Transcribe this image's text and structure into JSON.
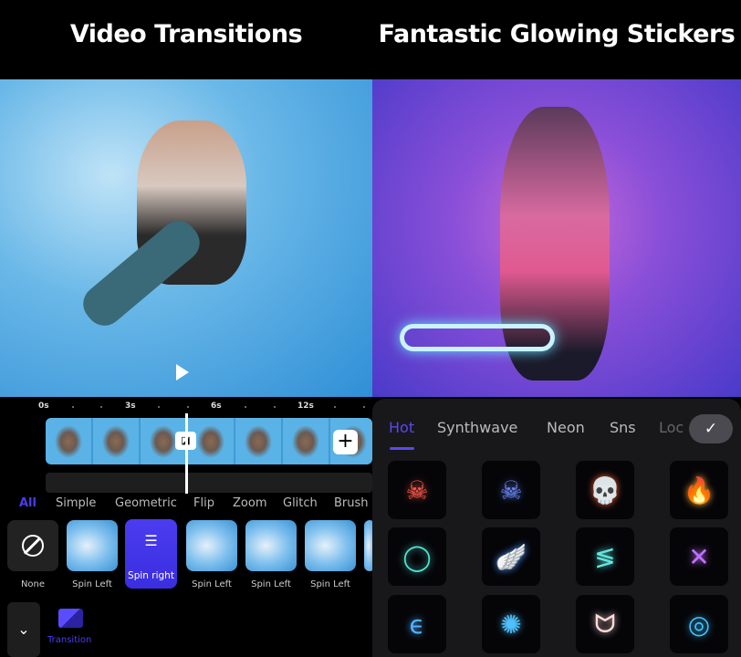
{
  "headlines": {
    "left": "Video Transitions",
    "right": "Fantastic Glowing Stickers"
  },
  "editor": {
    "timeline_ticks": [
      "0s",
      "3s",
      "6s",
      "12s"
    ],
    "transition_tabs": [
      "All",
      "Simple",
      "Geometric",
      "Flip",
      "Zoom",
      "Glitch",
      "Brush"
    ],
    "active_tab": "All",
    "transitions": [
      {
        "label": "None",
        "icon": "none-icon"
      },
      {
        "label": "Spin Left"
      },
      {
        "label": "Spin right",
        "selected": true,
        "icon": "sliders-icon"
      },
      {
        "label": "Spin Left"
      },
      {
        "label": "Spin Left"
      },
      {
        "label": "Spin Left"
      }
    ],
    "bottom_tool": "Transition",
    "accent": "#4a3cf0"
  },
  "stickers": {
    "tabs": [
      "Hot",
      "Synthwave",
      "Neon",
      "Sns",
      "Loc"
    ],
    "active_tab": "Hot",
    "items": [
      {
        "name": "neon-skull-red-icon",
        "glyph": "☠",
        "color": "#ff5a4a"
      },
      {
        "name": "neon-face-blue-icon",
        "glyph": "☠",
        "color": "#6a8aff"
      },
      {
        "name": "fire-skull-icon",
        "glyph": "💀",
        "color": "#ff6030"
      },
      {
        "name": "flame-icon",
        "glyph": "🔥",
        "color": "#ffb040"
      },
      {
        "name": "neon-ring-teal-icon",
        "glyph": "◯",
        "color": "#4fe0d0"
      },
      {
        "name": "neon-wing-blue-icon",
        "glyph": "🪽",
        "color": "#4a90ff"
      },
      {
        "name": "neon-swoosh-teal-icon",
        "glyph": "≶",
        "color": "#60e8e0"
      },
      {
        "name": "neon-cross-purple-icon",
        "glyph": "✕",
        "color": "#c070ff"
      },
      {
        "name": "neon-spiral-blue-icon",
        "glyph": "ϵ",
        "color": "#50b0ff"
      },
      {
        "name": "neon-burst-icon",
        "glyph": "✺",
        "color": "#50c0ff"
      },
      {
        "name": "white-wings-icon",
        "glyph": "ᗢ",
        "color": "#ffdada"
      },
      {
        "name": "neon-circle-icon",
        "glyph": "◎",
        "color": "#40c0ff"
      }
    ],
    "accent": "#5a48f0"
  }
}
